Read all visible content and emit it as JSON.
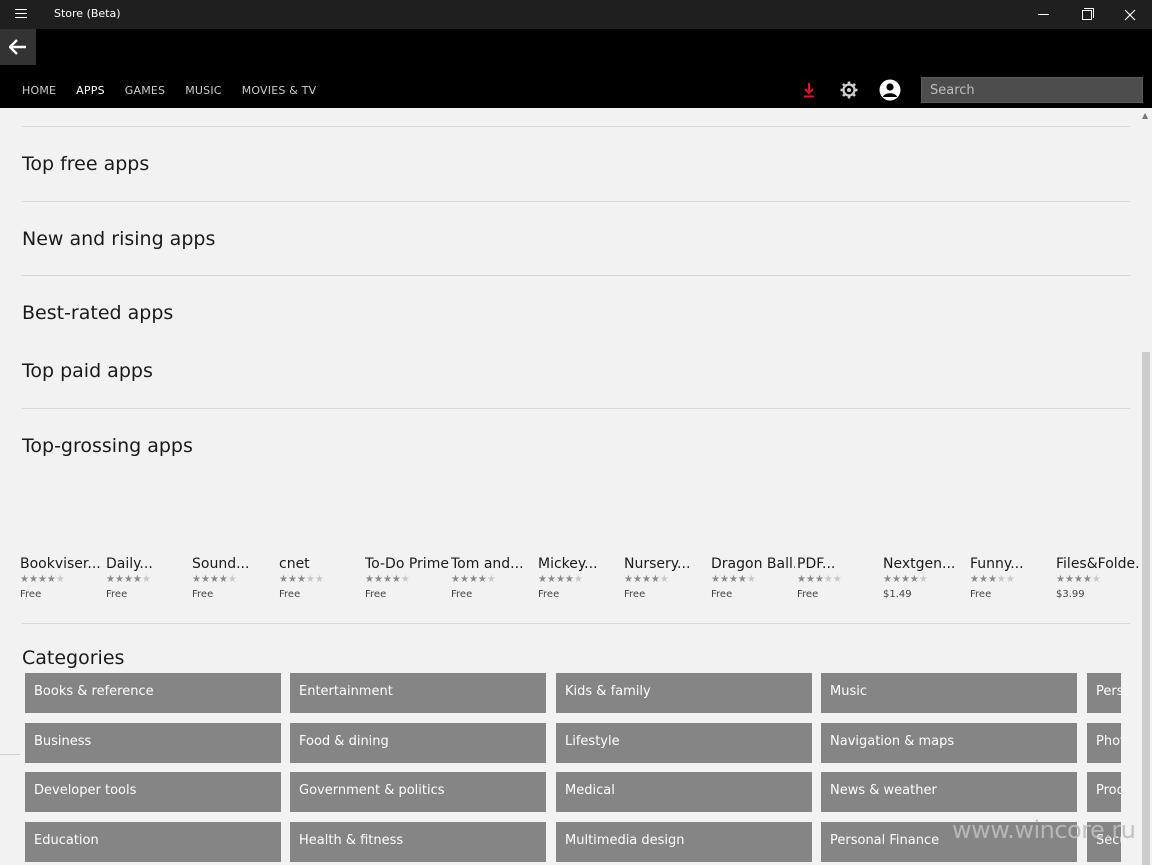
{
  "window": {
    "title": "Store (Beta)"
  },
  "nav": {
    "items": [
      "HOME",
      "APPS",
      "GAMES",
      "MUSIC",
      "MOVIES & TV"
    ],
    "active": "APPS"
  },
  "search": {
    "placeholder": "Search"
  },
  "colors": {
    "download_accent": "#e81123",
    "tile": "#858585"
  },
  "sections": [
    "Top free apps",
    "New and rising apps",
    "Best-rated apps",
    "Top paid apps",
    "Top-grossing apps"
  ],
  "apps": [
    {
      "name": "Bookviser...",
      "rating": 4,
      "price": "Free"
    },
    {
      "name": "Daily...",
      "rating": 4,
      "price": "Free"
    },
    {
      "name": "Sound...",
      "rating": 4,
      "price": "Free"
    },
    {
      "name": "cnet",
      "rating": 3.5,
      "price": "Free"
    },
    {
      "name": "To-Do Prime",
      "rating": 4.5,
      "price": "Free"
    },
    {
      "name": "Tom and...",
      "rating": 4.5,
      "price": "Free"
    },
    {
      "name": "Mickey...",
      "rating": 4.5,
      "price": "Free"
    },
    {
      "name": "Nursery...",
      "rating": 4,
      "price": "Free"
    },
    {
      "name": "Dragon Ball...",
      "rating": 4,
      "price": "Free"
    },
    {
      "name": "PDF...",
      "rating": 3,
      "price": "Free"
    },
    {
      "name": "Nextgen...",
      "rating": 4.5,
      "price": "$1.49"
    },
    {
      "name": "Funny...",
      "rating": 3.5,
      "price": "Free"
    },
    {
      "name": "Files&Folde...",
      "rating": 4,
      "price": "$3.99"
    }
  ],
  "categories_title": "Categories",
  "categories": [
    [
      "Books & reference",
      "Entertainment",
      "Kids & family",
      "Music",
      "Pers"
    ],
    [
      "Business",
      "Food & dining",
      "Lifestyle",
      "Navigation & maps",
      "Phot"
    ],
    [
      "Developer tools",
      "Government & politics",
      "Medical",
      "News & weather",
      "Prod"
    ],
    [
      "Education",
      "Health & fitness",
      "Multimedia design",
      "Personal Finance",
      "Secu"
    ]
  ],
  "watermark": "www.wincore.ru"
}
